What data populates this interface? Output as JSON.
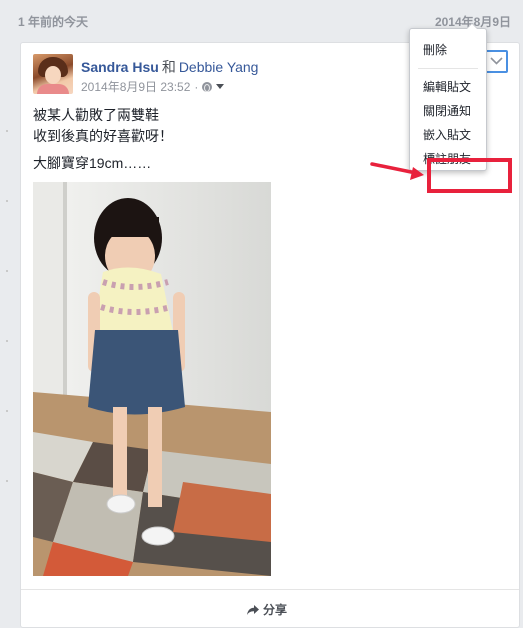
{
  "header": {
    "title": "1 年前的今天",
    "date": "2014年8月9日"
  },
  "post": {
    "author": "Sandra Hsu",
    "conjunction": "和",
    "tagged": "Debbie Yang",
    "timestamp": "2014年8月9日 23:52",
    "dot": "·",
    "text_lines": [
      "被某人勸敗了兩雙鞋",
      "收到後真的好喜歡呀！",
      "大腳寶穿19cm……"
    ]
  },
  "menu": {
    "items": [
      "刪除",
      "編輯貼文",
      "關閉通知",
      "嵌入貼文",
      "標註朋友"
    ],
    "highlighted_item": "嵌入貼文",
    "highlight_color": "#e8213c"
  },
  "share": {
    "label": "分享"
  },
  "icons": [
    "globe-icon",
    "caret-down-icon",
    "chevron-down-icon",
    "share-icon",
    "arrow-annotation-icon"
  ]
}
